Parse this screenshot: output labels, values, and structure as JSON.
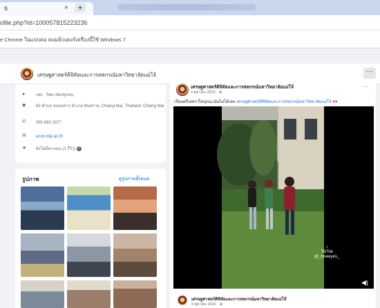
{
  "browser": {
    "tab_title": "s",
    "tab_close": "×",
    "new_tab": "+",
    "url": "ofile.php?id=100057815223236",
    "bookmark": "e Chrome ในแบบคอ คอมพิวเตอร์เครื่องนี้ใช้ Windows 7"
  },
  "page": {
    "name": "เศรษฐศาสตร์ดิจิทัลและการสหกรณ์มหาวิทยาลัยแม่โจ้",
    "more_button": "···"
  },
  "intro": {
    "rows": [
      {
        "icon": "info-icon",
        "text": "เพจ · วิทยาลัย/ชุมชน"
      },
      {
        "icon": "map-pin-icon",
        "text": "63 ตำบล หนองหาร อำเภอ สันทราย, Chiang Mai, Thailand, Chiang Mai"
      },
      {
        "icon": "phone-icon",
        "text": "090 893 1677"
      },
      {
        "icon": "globe-icon",
        "text": "econ.mju.ac.th"
      },
      {
        "icon": "star-icon",
        "text": "ยังไม่มีคะแนน (1 รีวิว)"
      }
    ]
  },
  "photos": {
    "title": "รูปภาพ",
    "see_all": "ดูรูปภาพทั้งหมด",
    "thumbnail_colors": [
      [
        "#6e8db5",
        "#b7c6a0",
        "#c9a67a"
      ],
      [
        "#8a9fb8",
        "#a9b39b",
        "#b88d6f"
      ],
      [
        "#9a8a7a",
        "#c0b6a8",
        "#a37a63"
      ]
    ]
  },
  "post": {
    "author": "เศรษฐศาสตร์ดิจิทัลและการสหกรณ์มหาวิทยาลัยแม่โจ้",
    "date": "4 ตุลาคม 2022 · ",
    "text_prefix": "เรียนครีเอทฯ ก็สนุกนะมันไม่ได้เลย ",
    "text_link": "เศรษฐศาสตร์ดิจิทัลและการสหกรณ์มหาวิทยาลัยแม่โจ้",
    "text_emoji": " ♥♥",
    "menu": "···",
    "video": {
      "watermark": "TikTok",
      "watermark_handle": "@_loveeyes_",
      "volume": "◀)"
    }
  },
  "post2": {
    "author": "เศรษฐศาสตร์ดิจิทัลและการสหกรณ์มหาวิทยาลัยแม่โจ้",
    "date": "3 ตุลาคม 2022 · "
  },
  "colors": {
    "facebook_blue": "#216fdb",
    "page_background": "#f0f2f5",
    "tab_strip": "#c8d6ee"
  }
}
